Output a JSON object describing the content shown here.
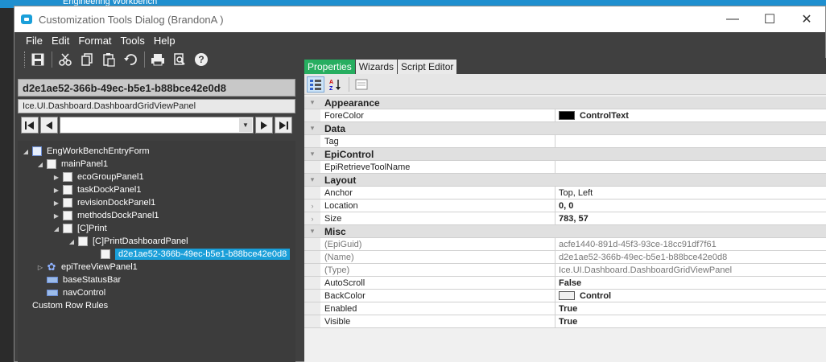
{
  "background": {
    "title": "Engineering Workbench"
  },
  "window": {
    "title": "Customization Tools Dialog  (BrandonA )",
    "controls": {
      "minimize": "—",
      "maximize": "☐",
      "close": "✕"
    }
  },
  "menu": [
    "File",
    "Edit",
    "Format",
    "Tools",
    "Help"
  ],
  "toolbar": {
    "icons": [
      "save-icon",
      "cut-icon",
      "copy-icon",
      "paste-icon",
      "undo-icon",
      "print-icon",
      "print-preview-icon",
      "help-icon"
    ]
  },
  "left": {
    "guid": "d2e1ae52-366b-49ec-b5e1-b88bce42e0d8",
    "type": "Ice.UI.Dashboard.DashboardGridViewPanel",
    "combo_value": ""
  },
  "tree": [
    {
      "label": "EngWorkBenchEntryForm",
      "expander": "◢",
      "icon": "form-icon"
    },
    {
      "label": "mainPanel1",
      "expander": "◢",
      "icon": "panel-icon"
    },
    {
      "label": "ecoGroupPanel1",
      "expander": "▶",
      "icon": "panel-icon"
    },
    {
      "label": "taskDockPanel1",
      "expander": "▶",
      "icon": "panel-icon"
    },
    {
      "label": "revisionDockPanel1",
      "expander": "▶",
      "icon": "panel-icon"
    },
    {
      "label": "methodsDockPanel1",
      "expander": "▶",
      "icon": "panel-icon"
    },
    {
      "label": "[C]Print",
      "expander": "◢",
      "icon": "panel-icon"
    },
    {
      "label": "[C]PrintDashboardPanel",
      "expander": "◢",
      "icon": "panel-icon"
    },
    {
      "label": "d2e1ae52-366b-49ec-b5e1-b88bce42e0d8",
      "expander": "",
      "icon": "panel-icon",
      "selected": true
    },
    {
      "label": "epiTreeViewPanel1",
      "expander": "▷",
      "icon": "gear-icon"
    },
    {
      "label": "baseStatusBar",
      "expander": "",
      "icon": "statusbar-icon"
    },
    {
      "label": "navControl",
      "expander": "",
      "icon": "navcontrol-icon"
    },
    {
      "label": "Custom Row Rules",
      "expander": "",
      "icon": ""
    }
  ],
  "tabs": [
    "Properties",
    "Wizards",
    "Script Editor"
  ],
  "property_grid": [
    {
      "type": "cat",
      "label": "Appearance"
    },
    {
      "type": "prop",
      "name": "ForeColor",
      "value": "ControlText",
      "swatch": "#000000"
    },
    {
      "type": "cat",
      "label": "Data"
    },
    {
      "type": "prop",
      "name": "Tag",
      "value": ""
    },
    {
      "type": "cat",
      "label": "EpiControl"
    },
    {
      "type": "prop",
      "name": "EpiRetrieveToolName",
      "value": ""
    },
    {
      "type": "cat",
      "label": "Layout"
    },
    {
      "type": "prop",
      "name": "Anchor",
      "value": "Top, Left"
    },
    {
      "type": "prop",
      "name": "Location",
      "value": "0, 0",
      "expandable": true,
      "bold": true
    },
    {
      "type": "prop",
      "name": "Size",
      "value": "783, 57",
      "expandable": true,
      "bold": true
    },
    {
      "type": "cat",
      "label": "Misc"
    },
    {
      "type": "prop",
      "name": "(EpiGuid)",
      "value": "acfe1440-891d-45f3-93ce-18cc91df7f61",
      "readonly": true
    },
    {
      "type": "prop",
      "name": "(Name)",
      "value": "d2e1ae52-366b-49ec-b5e1-b88bce42e0d8",
      "readonly": true
    },
    {
      "type": "prop",
      "name": "(Type)",
      "value": "Ice.UI.Dashboard.DashboardGridViewPanel",
      "readonly": true
    },
    {
      "type": "prop",
      "name": "AutoScroll",
      "value": "False",
      "bold": true
    },
    {
      "type": "prop",
      "name": "BackColor",
      "value": "Control",
      "swatch": "#f0f0f0",
      "bold": true
    },
    {
      "type": "prop",
      "name": "Enabled",
      "value": "True",
      "bold": true
    },
    {
      "type": "prop",
      "name": "Visible",
      "value": "True",
      "bold": true
    }
  ],
  "colors": {
    "accent": "#1a9fd9",
    "active_tab": "#27ae60",
    "dark_bg": "#404040"
  }
}
